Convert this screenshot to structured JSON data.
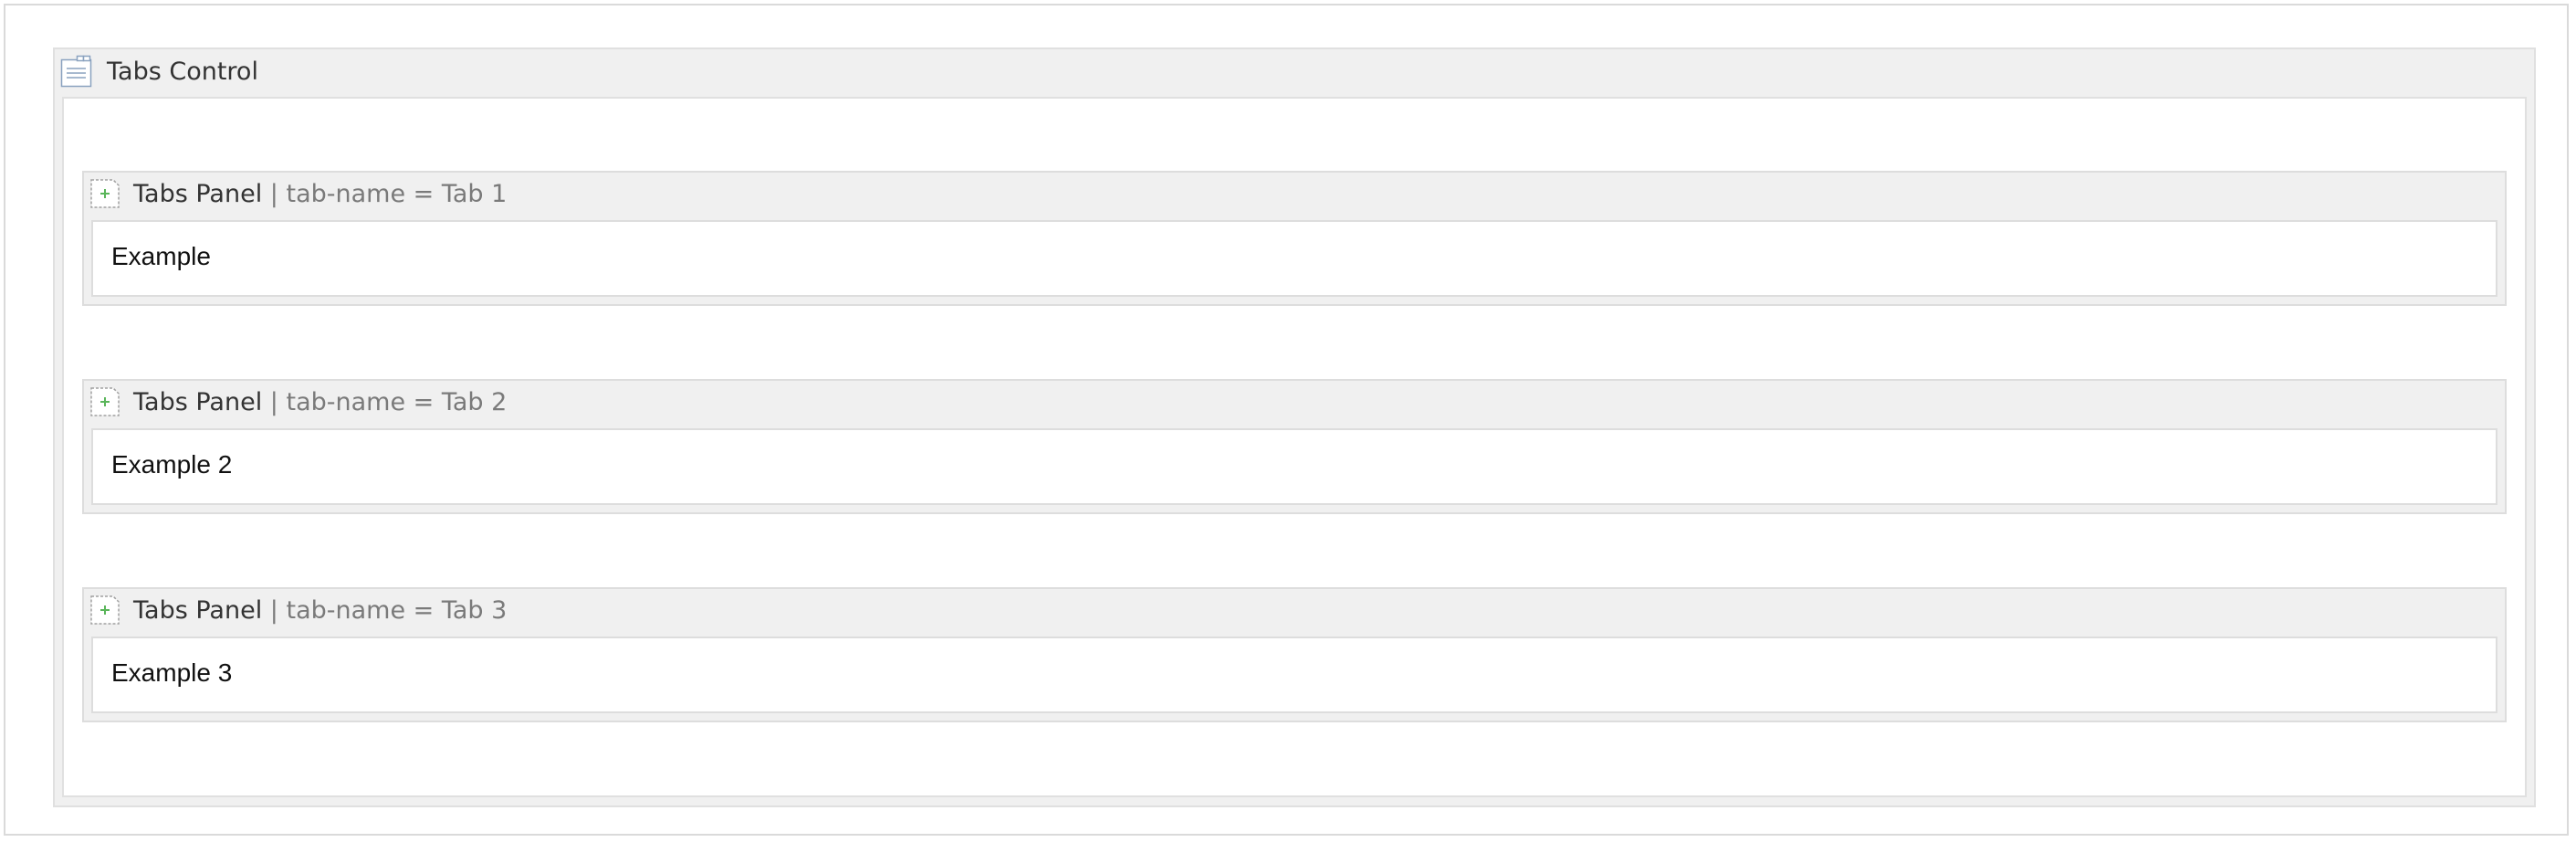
{
  "macro": {
    "title": "Tabs Control",
    "icon": "tabs-control-icon"
  },
  "panels": [
    {
      "name": "Tabs Panel",
      "params": "| tab-name = Tab 1",
      "content": "Example",
      "icon": "add-panel-icon"
    },
    {
      "name": "Tabs Panel",
      "params": "| tab-name = Tab 2",
      "content": "Example 2",
      "icon": "add-panel-icon"
    },
    {
      "name": "Tabs Panel",
      "params": "| tab-name = Tab 3",
      "content": "Example 3",
      "icon": "add-panel-icon"
    }
  ],
  "colors": {
    "header_bg": "#f0f0f0",
    "border": "#dddddd",
    "param_text": "#7a7a7a",
    "icon_plus": "#5ab55a"
  }
}
